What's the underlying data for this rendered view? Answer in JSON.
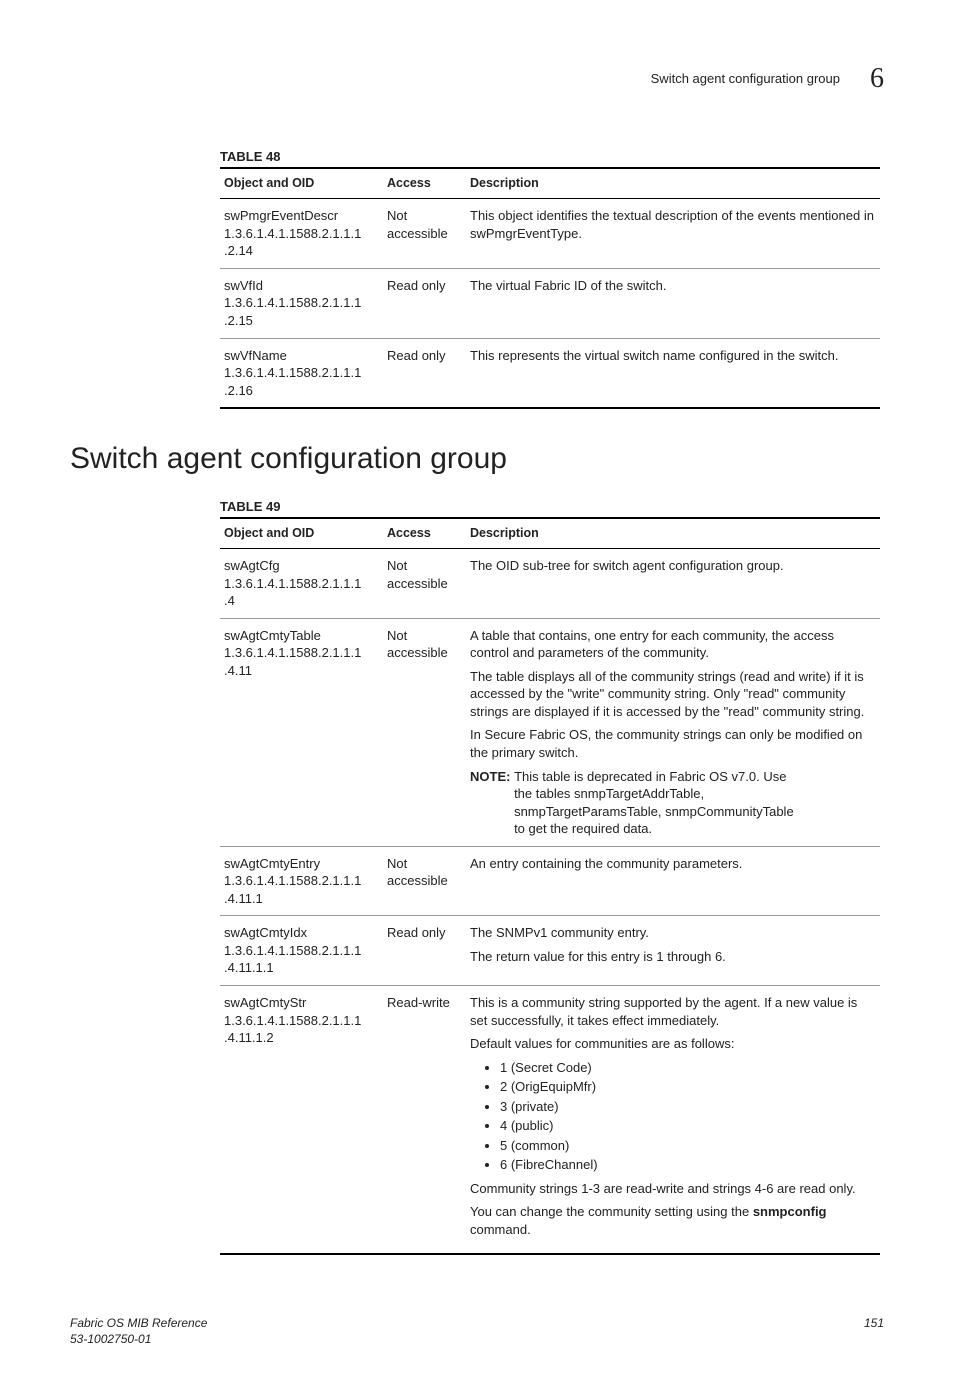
{
  "header": {
    "title": "Switch agent configuration group",
    "chapter": "6"
  },
  "table48": {
    "caption": "TABLE 48",
    "columns": [
      "Object and OID",
      "Access",
      "Description"
    ],
    "rows": [
      {
        "name": "swPmgrEventDescr",
        "oid": "1.3.6.1.4.1.1588.2.1.1.1.2.14",
        "access": "Not accessible",
        "desc": [
          {
            "type": "p",
            "text": "This object identifies the textual description of the events mentioned in swPmgrEventType."
          }
        ]
      },
      {
        "name": "swVfId",
        "oid": "1.3.6.1.4.1.1588.2.1.1.1.2.15",
        "access": "Read only",
        "desc": [
          {
            "type": "p",
            "text": "The virtual Fabric ID of the switch."
          }
        ]
      },
      {
        "name": "swVfName",
        "oid": "1.3.6.1.4.1.1588.2.1.1.1.2.16",
        "access": "Read only",
        "desc": [
          {
            "type": "p",
            "text": "This represents the virtual switch name configured in the switch."
          }
        ]
      }
    ]
  },
  "heading": "Switch agent configuration group",
  "table49": {
    "caption": "TABLE 49",
    "columns": [
      "Object and OID",
      "Access",
      "Description"
    ],
    "rows": [
      {
        "name": "swAgtCfg",
        "oid": "1.3.6.1.4.1.1588.2.1.1.1.4",
        "access": "Not accessible",
        "desc": [
          {
            "type": "p",
            "text": "The OID sub-tree for switch agent configuration group."
          }
        ]
      },
      {
        "name": "swAgtCmtyTable",
        "oid": "1.3.6.1.4.1.1588.2.1.1.1.4.11",
        "access": "Not accessible",
        "desc": [
          {
            "type": "p",
            "text": "A table that contains, one entry for each community, the access control and parameters of the community."
          },
          {
            "type": "p",
            "text": "The table displays all of the community strings (read and write) if it is accessed by the \"write\" community string. Only \"read\" community strings are displayed if it is accessed by the \"read\" community string."
          },
          {
            "type": "p",
            "text": "In Secure Fabric OS, the community strings can only be modified on the primary switch."
          },
          {
            "type": "note",
            "label": "NOTE:",
            "text": "This table is deprecated in Fabric OS v7.0. Use the tables snmpTargetAddrTable, snmpTargetParamsTable, snmpCommunityTable to get the required data."
          }
        ]
      },
      {
        "name": "swAgtCmtyEntry",
        "oid": "1.3.6.1.4.1.1588.2.1.1.1.4.11.1",
        "access": "Not accessible",
        "desc": [
          {
            "type": "p",
            "text": "An entry containing the community parameters."
          }
        ]
      },
      {
        "name": "swAgtCmtyIdx",
        "oid": "1.3.6.1.4.1.1588.2.1.1.1.4.11.1.1",
        "access": "Read only",
        "desc": [
          {
            "type": "p",
            "text": "The SNMPv1 community entry."
          },
          {
            "type": "p",
            "text": "The return value for this entry is 1 through 6."
          }
        ]
      },
      {
        "name": "swAgtCmtyStr",
        "oid": "1.3.6.1.4.1.1588.2.1.1.1.4.11.1.2",
        "access": "Read-write",
        "desc": [
          {
            "type": "p",
            "text": "This is a community string supported by the agent. If a new value is set successfully, it takes effect immediately."
          },
          {
            "type": "p",
            "text": "Default values for communities are as follows:"
          },
          {
            "type": "ul",
            "items": [
              "1 (Secret Code)",
              "2 (OrigEquipMfr)",
              "3 (private)",
              "4 (public)",
              "5 (common)",
              "6 (FibreChannel)"
            ]
          },
          {
            "type": "p",
            "text": "Community strings 1-3 are read-write and strings 4-6 are read only."
          },
          {
            "type": "p_bold",
            "prefix": "You can change the community setting using the ",
            "bold": "snmpconfig",
            "suffix": " command."
          }
        ]
      }
    ]
  },
  "footer": {
    "left1": "Fabric OS MIB Reference",
    "left2": "53-1002750-01",
    "right": "151"
  }
}
